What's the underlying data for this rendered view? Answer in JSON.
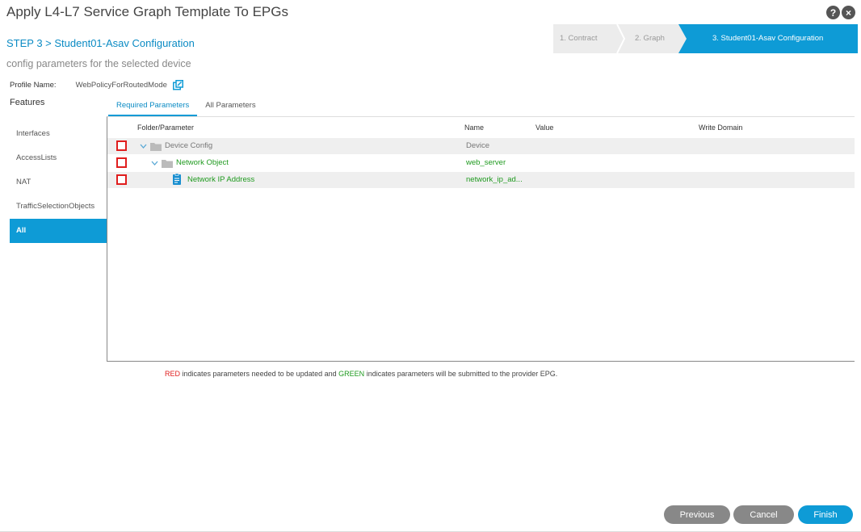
{
  "header": {
    "title": "Apply L4-L7 Service Graph Template To EPGs",
    "help_icon": "?",
    "close_icon": "×"
  },
  "step_title": "STEP 3 > Student01-Asav Configuration",
  "subtitle": "config parameters for the selected device",
  "wizard": {
    "steps": [
      "1. Contract",
      "2. Graph",
      "3. Student01-Asav Configuration"
    ],
    "active_index": 2
  },
  "profile": {
    "label": "Profile Name:",
    "value": "WebPolicyForRoutedMode"
  },
  "features": {
    "title": "Features",
    "items": [
      "Interfaces",
      "AccessLists",
      "NAT",
      "TrafficSelectionObjects",
      "All"
    ],
    "active": "All"
  },
  "tabs": {
    "required": "Required Parameters",
    "all": "All Parameters"
  },
  "grid": {
    "columns": {
      "folder": "Folder/Parameter",
      "name": "Name",
      "value": "Value",
      "write_domain": "Write Domain"
    },
    "rows": [
      {
        "label": "Device Config",
        "name": "Device"
      },
      {
        "label": "Network Object",
        "name": "web_server"
      },
      {
        "label": "Network IP Address",
        "name": "network_ip_ad..."
      }
    ]
  },
  "legend": {
    "red": "RED",
    "red_text": " indicates parameters needed to be updated and ",
    "green": "GREEN",
    "green_text": " indicates parameters will be submitted to the provider EPG."
  },
  "buttons": {
    "previous": "Previous",
    "cancel": "Cancel",
    "finish": "Finish"
  },
  "colors": {
    "accent": "#0e9bd6",
    "required": "#e01e1e",
    "submitted": "#1f9a1f"
  }
}
